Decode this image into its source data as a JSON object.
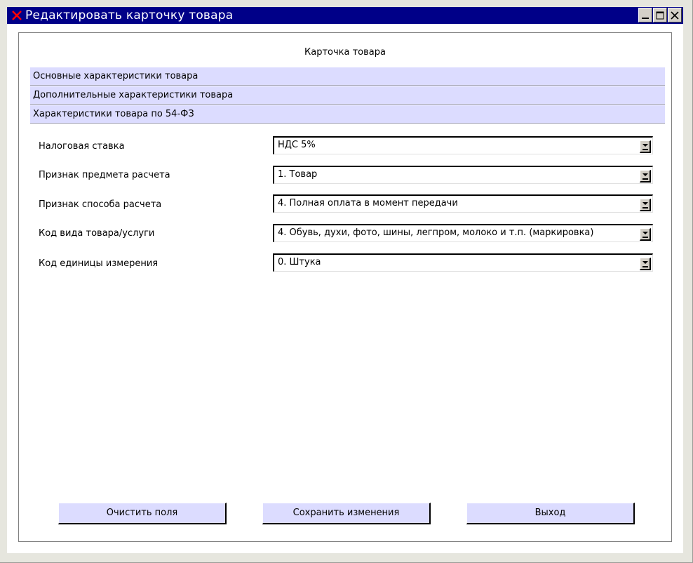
{
  "window": {
    "title": "Редактировать карточку товара",
    "icon": "x-app-icon",
    "controls": [
      "minimize",
      "maximize",
      "close"
    ]
  },
  "card": {
    "title": "Карточка товара",
    "sections": [
      {
        "label": "Основные характеристики товара"
      },
      {
        "label": "Дополнительные характеристики товара"
      },
      {
        "label": "Характеристики товара по 54-ФЗ"
      }
    ],
    "fields": [
      {
        "label": "Налоговая ставка",
        "value": "НДС 5%"
      },
      {
        "label": "Признак предмета расчета",
        "value": "1. Товар"
      },
      {
        "label": "Признак способа расчета",
        "value": "4. Полная оплата в момент передачи"
      },
      {
        "label": "Код вида товара/услуги",
        "value": "4. Обувь, духи, фото, шины, легпром, молоко и т.п. (маркировка)"
      },
      {
        "label": "Код единицы измерения",
        "value": "0. Штука"
      }
    ]
  },
  "buttons": {
    "clear": "Очистить поля",
    "save": "Сохранить изменения",
    "exit": "Выход"
  },
  "colors": {
    "titlebar": "#000088",
    "section_bg": "#dcdcff",
    "button_bg": "#dcdcff",
    "app_icon": "#ff0000"
  }
}
